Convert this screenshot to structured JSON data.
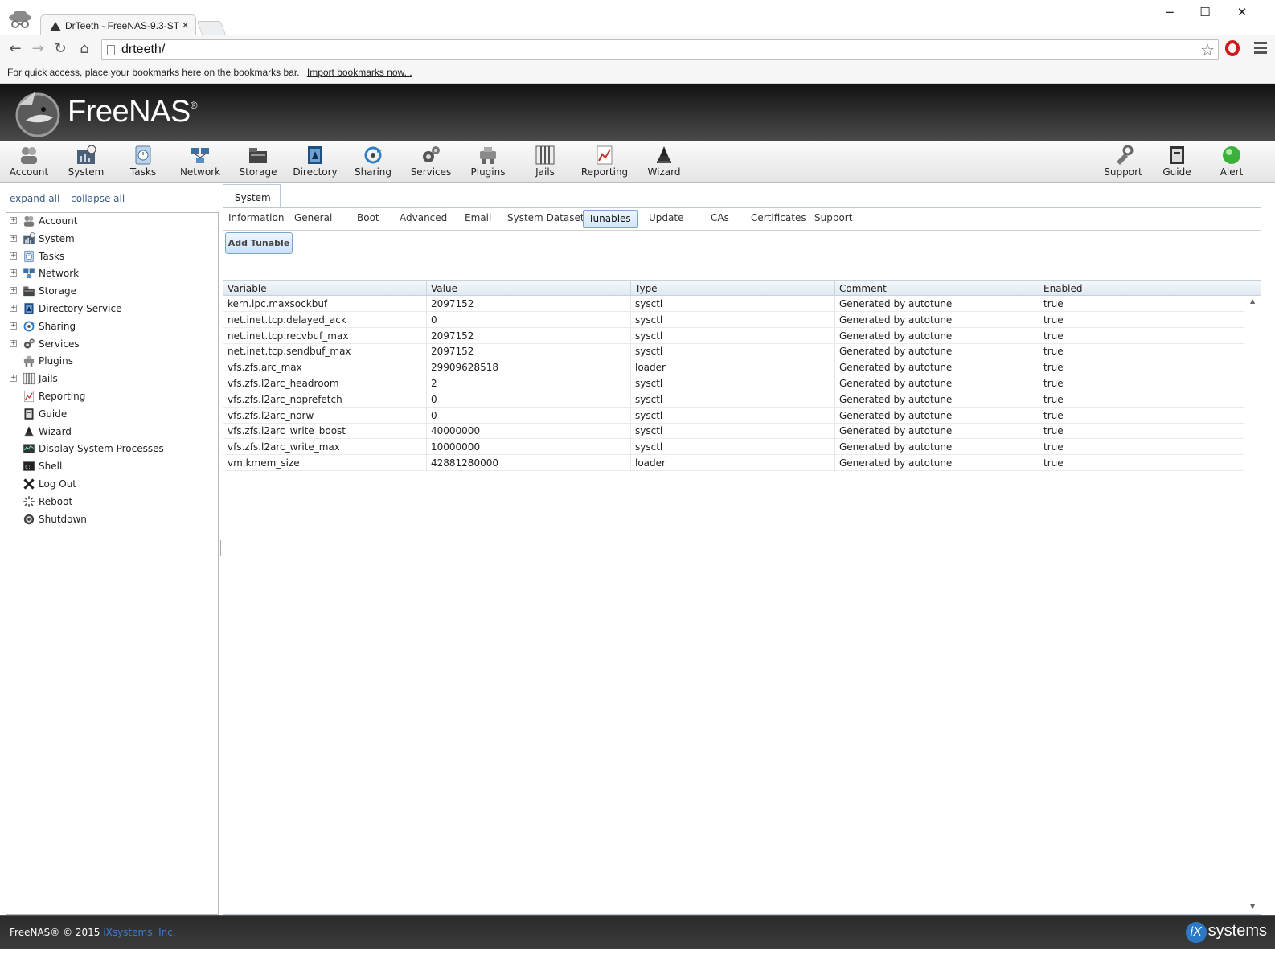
{
  "browser": {
    "tab_title": "DrTeeth - FreeNAS-9.3-ST",
    "tab_close": "×",
    "url": "drteeth/",
    "bookmarks_text": "For quick access, place your bookmarks here on the bookmarks bar.",
    "bookmarks_link": "Import bookmarks now...",
    "win_min": "−",
    "win_max": "☐",
    "win_close": "✕",
    "back": "←",
    "forward": "→",
    "reload": "↻",
    "home": "⌂",
    "star": "☆"
  },
  "brand": {
    "logo_text": "FreeNAS",
    "logo_reg": "®"
  },
  "toolbar": {
    "left": [
      {
        "label": "Account",
        "icon": "account-icon"
      },
      {
        "label": "System",
        "icon": "system-icon"
      },
      {
        "label": "Tasks",
        "icon": "tasks-icon"
      },
      {
        "label": "Network",
        "icon": "network-icon"
      },
      {
        "label": "Storage",
        "icon": "storage-icon"
      },
      {
        "label": "Directory",
        "icon": "directory-icon"
      },
      {
        "label": "Sharing",
        "icon": "sharing-icon"
      },
      {
        "label": "Services",
        "icon": "services-icon"
      },
      {
        "label": "Plugins",
        "icon": "plugins-icon"
      },
      {
        "label": "Jails",
        "icon": "jails-icon"
      },
      {
        "label": "Reporting",
        "icon": "reporting-icon"
      },
      {
        "label": "Wizard",
        "icon": "wizard-icon"
      }
    ],
    "right": [
      {
        "label": "Support",
        "icon": "support-icon"
      },
      {
        "label": "Guide",
        "icon": "guide-icon"
      },
      {
        "label": "Alert",
        "icon": "alert-icon"
      }
    ]
  },
  "sidebar": {
    "expand_all": "expand all",
    "collapse_all": "collapse all",
    "items": [
      {
        "label": "Account",
        "expandable": true,
        "icon": "account-icon"
      },
      {
        "label": "System",
        "expandable": true,
        "icon": "system-icon"
      },
      {
        "label": "Tasks",
        "expandable": true,
        "icon": "tasks-icon"
      },
      {
        "label": "Network",
        "expandable": true,
        "icon": "network-icon"
      },
      {
        "label": "Storage",
        "expandable": true,
        "icon": "storage-icon"
      },
      {
        "label": "Directory Service",
        "expandable": true,
        "icon": "directory-icon"
      },
      {
        "label": "Sharing",
        "expandable": true,
        "icon": "sharing-icon"
      },
      {
        "label": "Services",
        "expandable": true,
        "icon": "services-icon"
      },
      {
        "label": "Plugins",
        "expandable": false,
        "icon": "plugins-icon"
      },
      {
        "label": "Jails",
        "expandable": true,
        "icon": "jails-icon"
      },
      {
        "label": "Reporting",
        "expandable": false,
        "icon": "reporting-icon"
      },
      {
        "label": "Guide",
        "expandable": false,
        "icon": "guide-icon"
      },
      {
        "label": "Wizard",
        "expandable": false,
        "icon": "wizard-icon"
      },
      {
        "label": "Display System Processes",
        "expandable": false,
        "icon": "processes-icon"
      },
      {
        "label": "Shell",
        "expandable": false,
        "icon": "shell-icon"
      },
      {
        "label": "Log Out",
        "expandable": false,
        "icon": "logout-icon"
      },
      {
        "label": "Reboot",
        "expandable": false,
        "icon": "reboot-icon"
      },
      {
        "label": "Shutdown",
        "expandable": false,
        "icon": "shutdown-icon"
      }
    ]
  },
  "main": {
    "tab": "System",
    "subtabs": [
      "Information",
      "General",
      "Boot",
      "Advanced",
      "Email",
      "System Dataset",
      "Tunables",
      "Update",
      "CAs",
      "Certificates",
      "Support"
    ],
    "active_subtab": "Tunables",
    "add_button": "Add Tunable",
    "table": {
      "columns": [
        "Variable",
        "Value",
        "Type",
        "Comment",
        "Enabled"
      ],
      "rows": [
        [
          "kern.ipc.maxsockbuf",
          "2097152",
          "sysctl",
          "Generated by autotune",
          "true"
        ],
        [
          "net.inet.tcp.delayed_ack",
          "0",
          "sysctl",
          "Generated by autotune",
          "true"
        ],
        [
          "net.inet.tcp.recvbuf_max",
          "2097152",
          "sysctl",
          "Generated by autotune",
          "true"
        ],
        [
          "net.inet.tcp.sendbuf_max",
          "2097152",
          "sysctl",
          "Generated by autotune",
          "true"
        ],
        [
          "vfs.zfs.arc_max",
          "29909628518",
          "loader",
          "Generated by autotune",
          "true"
        ],
        [
          "vfs.zfs.l2arc_headroom",
          "2",
          "sysctl",
          "Generated by autotune",
          "true"
        ],
        [
          "vfs.zfs.l2arc_noprefetch",
          "0",
          "sysctl",
          "Generated by autotune",
          "true"
        ],
        [
          "vfs.zfs.l2arc_norw",
          "0",
          "sysctl",
          "Generated by autotune",
          "true"
        ],
        [
          "vfs.zfs.l2arc_write_boost",
          "40000000",
          "sysctl",
          "Generated by autotune",
          "true"
        ],
        [
          "vfs.zfs.l2arc_write_max",
          "10000000",
          "sysctl",
          "Generated by autotune",
          "true"
        ],
        [
          "vm.kmem_size",
          "42881280000",
          "loader",
          "Generated by autotune",
          "true"
        ]
      ]
    }
  },
  "footer": {
    "copyright": "FreeNAS® © 2015",
    "company": "iXsystems, Inc.",
    "logo_ix": "iX",
    "logo_text": "systems"
  },
  "colors": {
    "header_bg": "#2c2c2c",
    "accent": "#7aa5d2",
    "link": "#3b7fc4"
  }
}
